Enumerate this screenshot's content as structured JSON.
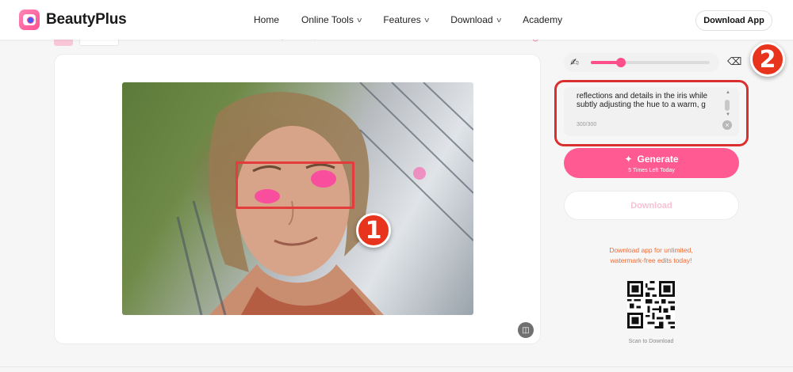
{
  "app": {
    "name": "BeautyPlus"
  },
  "nav": {
    "items": [
      {
        "label": "Home",
        "has_dropdown": false
      },
      {
        "label": "Online Tools",
        "has_dropdown": true
      },
      {
        "label": "Features",
        "has_dropdown": true
      },
      {
        "label": "Download",
        "has_dropdown": true
      },
      {
        "label": "Academy",
        "has_dropdown": false
      }
    ],
    "cta_label": "Download App"
  },
  "editor": {
    "brush": {
      "size_fraction": 0.25
    },
    "prompt": {
      "text": "reflections and details in the iris while subtly adjusting the hue to a warm, g",
      "char_count": "300/300"
    },
    "generate": {
      "label": "Generate",
      "sub_label": "5 Times Left Today"
    },
    "download_label": "Download",
    "promo_lines": [
      "Download app for unlimited,",
      "watermark-free edits today!"
    ],
    "scan_label": "Scan to Download"
  },
  "annotations": {
    "badge_1": "1",
    "badge_2": "2"
  },
  "colors": {
    "accent_pink": "#ff5a91",
    "annotation_red": "#e43c3c",
    "promo_orange": "#f06a33"
  }
}
